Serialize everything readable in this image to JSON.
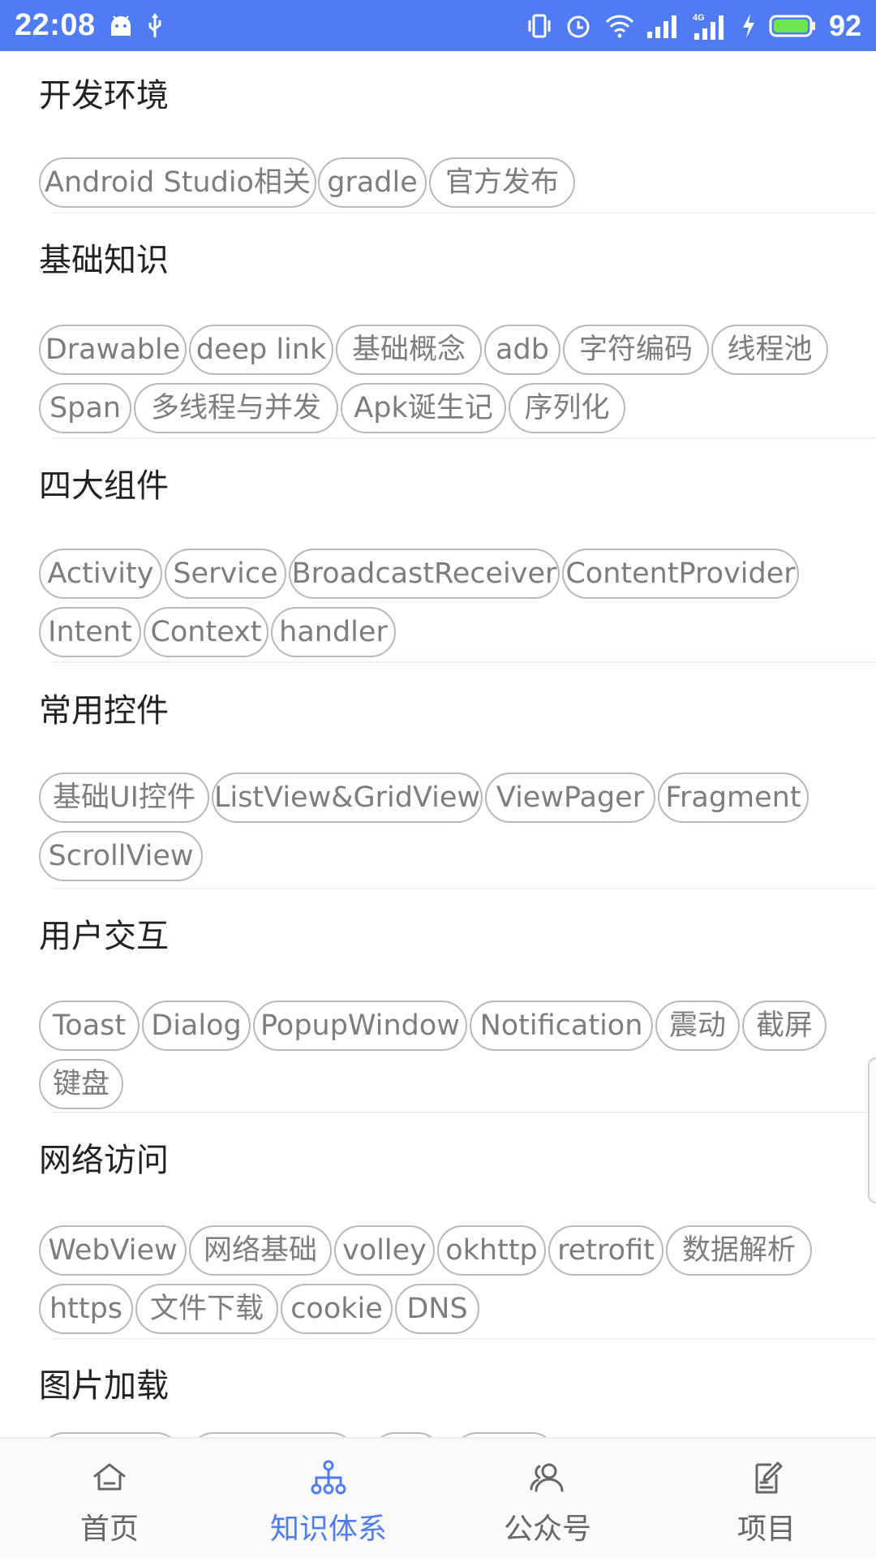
{
  "status_bar": {
    "time": "22:08",
    "battery": "92",
    "icons": [
      "android-icon",
      "usb-icon",
      "vibrate-icon",
      "alarm-icon",
      "wifi-icon",
      "signal-icon",
      "signal-4g-icon",
      "charging-icon",
      "battery-icon"
    ]
  },
  "sections": [
    {
      "title": "开发环境",
      "tags": [
        "Android Studio相关",
        "gradle",
        "官方发布"
      ]
    },
    {
      "title": "基础知识",
      "tags": [
        "Drawable",
        "deep link",
        "基础概念",
        "adb",
        "字符编码",
        "线程池",
        "Span",
        "多线程与并发",
        "Apk诞生记",
        "序列化"
      ]
    },
    {
      "title": "四大组件",
      "tags": [
        "Activity",
        "Service",
        "BroadcastReceiver",
        "ContentProvider",
        "Intent",
        "Context",
        "handler"
      ]
    },
    {
      "title": "常用控件",
      "tags": [
        "基础UI控件",
        "ListView&GridView",
        "ViewPager",
        "Fragment",
        "ScrollView"
      ]
    },
    {
      "title": "用户交互",
      "tags": [
        "Toast",
        "Dialog",
        "PopupWindow",
        "Notification",
        "震动",
        "截屏",
        "键盘"
      ]
    },
    {
      "title": "网络访问",
      "tags": [
        "WebView",
        "网络基础",
        "volley",
        "okhttp",
        "retrofit",
        "数据解析",
        "https",
        "文件下载",
        "cookie",
        "DNS"
      ]
    },
    {
      "title": "图片加载",
      "tags": []
    }
  ],
  "bottom_nav": {
    "items": [
      {
        "label": "首页",
        "icon": "home-icon",
        "active": false
      },
      {
        "label": "知识体系",
        "icon": "tree-icon",
        "active": true
      },
      {
        "label": "公众号",
        "icon": "people-icon",
        "active": false
      },
      {
        "label": "项目",
        "icon": "clipboard-icon",
        "active": false
      }
    ]
  },
  "colors": {
    "accent": "#4f7cf2",
    "tag_border": "#b7b7b7",
    "tag_text": "#7d7d7d"
  }
}
